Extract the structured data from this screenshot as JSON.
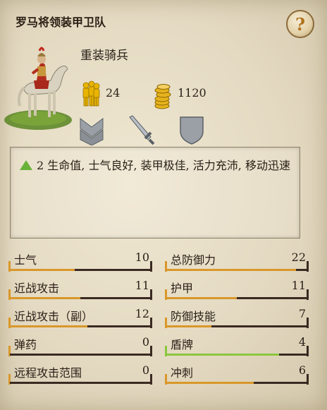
{
  "unit": {
    "name": "罗马将领装甲卫队",
    "class": "重装骑兵",
    "men": "24",
    "cost": "1120",
    "help_label": "?"
  },
  "description": "2 生命值, 士气良好, 装甲极佳, 活力充沛, 移动迅速",
  "stats_left": [
    {
      "label": "士气",
      "value": "10",
      "fill": 0.46,
      "color": "#d9972a"
    },
    {
      "label": "近战攻击",
      "value": "11",
      "fill": 0.5,
      "color": "#d9972a"
    },
    {
      "label": "近战攻击（副）",
      "value": "12",
      "fill": 0.55,
      "color": "#d9972a"
    },
    {
      "label": "弹药",
      "value": "0",
      "fill": 0.0,
      "color": "#d9972a"
    },
    {
      "label": "远程攻击范围",
      "value": "0",
      "fill": 0.0,
      "color": "#d9972a"
    }
  ],
  "stats_right": [
    {
      "label": "总防御力",
      "value": "22",
      "fill": 0.92,
      "color": "#d9972a"
    },
    {
      "label": "护甲",
      "value": "11",
      "fill": 0.5,
      "color": "#d9972a"
    },
    {
      "label": "防御技能",
      "value": "7",
      "fill": 0.32,
      "color": "#d9972a"
    },
    {
      "label": "盾牌",
      "value": "4",
      "fill": 0.8,
      "color": "#8cc63f"
    },
    {
      "label": "冲刺",
      "value": "6",
      "fill": 0.62,
      "color": "#d9972a"
    }
  ],
  "icons": {
    "help": "question-icon",
    "men": "soldiers-icon",
    "cost": "coins-icon",
    "rank": "chevron-rank-icon",
    "weapon": "sword-icon",
    "armour": "shield-icon"
  }
}
